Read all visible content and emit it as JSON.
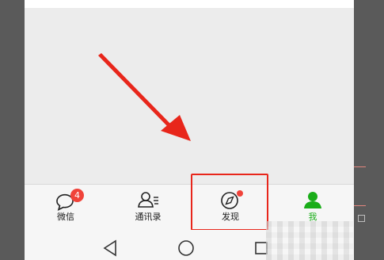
{
  "tabbar": {
    "tabs": [
      {
        "label": "微信",
        "icon": "chat-bubble-icon",
        "badge": "4",
        "active": false
      },
      {
        "label": "通讯录",
        "icon": "contacts-icon",
        "active": false
      },
      {
        "label": "发现",
        "icon": "compass-icon",
        "has_dot": true,
        "active": false
      },
      {
        "label": "我",
        "icon": "person-icon",
        "active": true
      }
    ]
  },
  "navbar": {
    "buttons": [
      {
        "icon": "back-triangle-icon"
      },
      {
        "icon": "home-circle-icon"
      },
      {
        "icon": "recents-square-icon"
      }
    ]
  },
  "annotation": {
    "arrow_color": "#e8261b",
    "highlight_color": "#e8261b"
  },
  "colors": {
    "accent": "#1aad19",
    "badge": "#f0433a",
    "background": "#ececec"
  }
}
